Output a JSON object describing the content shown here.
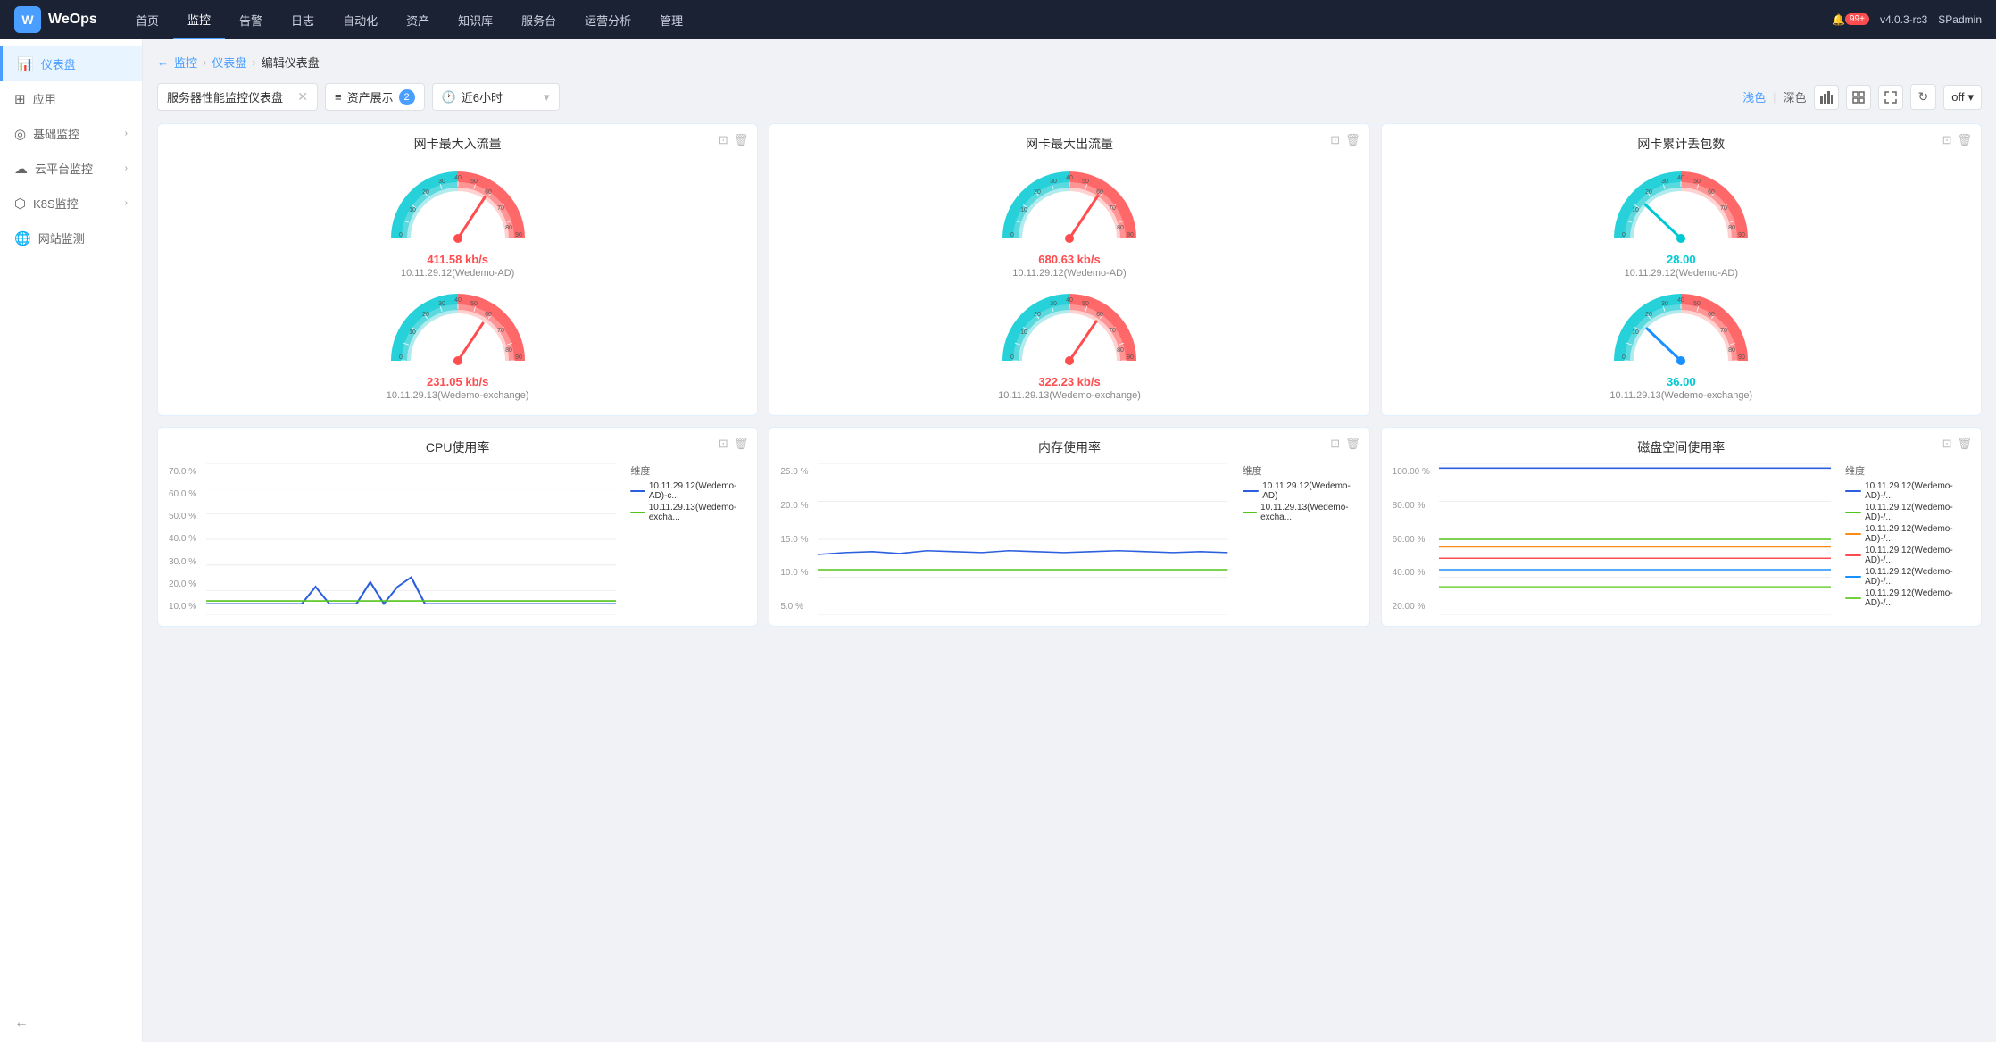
{
  "app": {
    "name": "WeOps",
    "version": "v4.0.3-rc3",
    "user": "SPadmin",
    "notifications": "99+"
  },
  "nav": {
    "items": [
      {
        "label": "首页",
        "active": false
      },
      {
        "label": "监控",
        "active": true
      },
      {
        "label": "告警",
        "active": false
      },
      {
        "label": "日志",
        "active": false
      },
      {
        "label": "自动化",
        "active": false
      },
      {
        "label": "资产",
        "active": false
      },
      {
        "label": "知识库",
        "active": false
      },
      {
        "label": "服务台",
        "active": false
      },
      {
        "label": "运营分析",
        "active": false
      },
      {
        "label": "管理",
        "active": false
      }
    ]
  },
  "sidebar": {
    "items": [
      {
        "label": "仪表盘",
        "icon": "📊",
        "active": true
      },
      {
        "label": "应用",
        "icon": "⊞",
        "active": false
      },
      {
        "label": "基础监控",
        "icon": "◎",
        "active": false,
        "hasArrow": true
      },
      {
        "label": "云平台监控",
        "icon": "☁",
        "active": false,
        "hasArrow": true
      },
      {
        "label": "K8S监控",
        "icon": "⬡",
        "active": false,
        "hasArrow": true
      },
      {
        "label": "网站监测",
        "icon": "🌐",
        "active": false
      }
    ]
  },
  "breadcrumb": {
    "back": "←",
    "path": [
      "监控",
      "仪表盘"
    ],
    "current": "编辑仪表盘"
  },
  "toolbar": {
    "dashboard_name": "服务器性能监控仪表盘",
    "asset_label": "资产展示",
    "asset_count": "2",
    "time_icon": "🕐",
    "time_label": "近6小时",
    "theme_light": "浅色",
    "theme_dark": "深色",
    "off_label": "off"
  },
  "widgets": [
    {
      "id": "w1",
      "title": "网卡最大入流量",
      "type": "gauge",
      "gauges": [
        {
          "value": "411.58 kb/s",
          "label": "10.11.29.12(Wedemo-AD)",
          "color": "red"
        },
        {
          "value": "231.05 kb/s",
          "label": "10.11.29.13(Wedemo-exchange)",
          "color": "red"
        }
      ]
    },
    {
      "id": "w2",
      "title": "网卡最大出流量",
      "type": "gauge",
      "gauges": [
        {
          "value": "680.63 kb/s",
          "label": "10.11.29.12(Wedemo-AD)",
          "color": "red"
        },
        {
          "value": "322.23 kb/s",
          "label": "10.11.29.13(Wedemo-exchange)",
          "color": "red"
        }
      ]
    },
    {
      "id": "w3",
      "title": "网卡累计丢包数",
      "type": "gauge",
      "gauges": [
        {
          "value": "28.00",
          "label": "10.11.29.12(Wedemo-AD)",
          "color": "cyan"
        },
        {
          "value": "36.00",
          "label": "10.11.29.13(Wedemo-exchange)",
          "color": "cyan"
        }
      ]
    },
    {
      "id": "w4",
      "title": "CPU使用率",
      "type": "line",
      "legend_title": "维度",
      "legend": [
        {
          "label": "10.11.29.12(Wedemo-AD)-c...",
          "color": "#2b5fde"
        },
        {
          "label": "10.11.29.13(Wedemo-excha...",
          "color": "#52c41a"
        }
      ],
      "yaxis": [
        "70.0 %",
        "60.0 %",
        "50.0 %",
        "40.0 %",
        "30.0 %",
        "20.0 %",
        "10.0 %"
      ]
    },
    {
      "id": "w5",
      "title": "内存使用率",
      "type": "line",
      "legend_title": "维度",
      "legend": [
        {
          "label": "10.11.29.12(Wedemo-AD)",
          "color": "#2b5fde"
        },
        {
          "label": "10.11.29.13(Wedemo-excha...",
          "color": "#52c41a"
        }
      ],
      "yaxis": [
        "25.0 %",
        "20.0 %",
        "15.0 %",
        "10.0 %",
        "5.0 %"
      ]
    },
    {
      "id": "w6",
      "title": "磁盘空间使用率",
      "type": "line",
      "legend_title": "维度",
      "legend": [
        {
          "label": "10.11.29.12(Wedemo-AD)-/...",
          "color": "#2b5fde"
        },
        {
          "label": "10.11.29.12(Wedemo-AD)-/...",
          "color": "#52c41a"
        },
        {
          "label": "10.11.29.12(Wedemo-AD)-/...",
          "color": "#fa8c16"
        },
        {
          "label": "10.11.29.12(Wedemo-AD)-/...",
          "color": "#ff4d4f"
        },
        {
          "label": "10.11.29.12(Wedemo-AD)-/...",
          "color": "#1890ff"
        },
        {
          "label": "10.11.29.12(Wedemo-AD)-/...",
          "color": "#73d13d"
        }
      ],
      "yaxis": [
        "100.00 %",
        "80.00 %",
        "60.00 %",
        "40.00 %",
        "20.00 %"
      ]
    }
  ]
}
